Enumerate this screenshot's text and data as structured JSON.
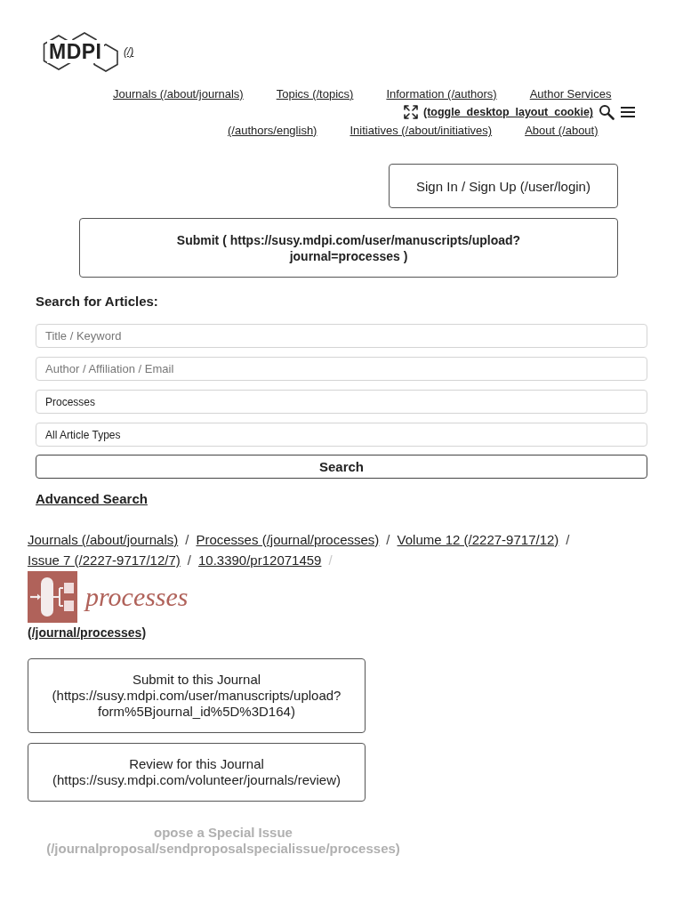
{
  "header": {
    "logo": {
      "text": "MDPI",
      "link": "(/)"
    },
    "nav_rows": [
      [
        {
          "label": "Journals (/about/journals)"
        },
        {
          "label": "Topics (/topics)"
        },
        {
          "label": "Information (/authors)"
        },
        {
          "label": "Author Services"
        }
      ],
      [
        {
          "label": "(/authors/english)"
        },
        {
          "label": "Initiatives (/about/initiatives)"
        },
        {
          "label": "About (/about)"
        }
      ]
    ],
    "layout_toggle": {
      "label": "(toggle_desktop_layout_cookie)"
    },
    "sign_in_button": "Sign In / Sign Up (/user/login)",
    "submit_button": "Submit ( https://susy.mdpi.com/user/manuscripts/upload?journal=processes )"
  },
  "search": {
    "title": "Search for Articles:",
    "fields": [
      {
        "kind": "input",
        "placeholder": "Title / Keyword"
      },
      {
        "kind": "input",
        "placeholder": "Author / Affiliation / Email"
      },
      {
        "kind": "select",
        "value": "Processes"
      },
      {
        "kind": "select",
        "value": "All Article Types"
      }
    ],
    "button": "Search",
    "advanced_link": "Advanced Search"
  },
  "breadcrumb": [
    {
      "kind": "link",
      "text": "Journals (/about/journals)"
    },
    {
      "kind": "separator",
      "text": "/",
      "muted": false
    },
    {
      "kind": "link",
      "text": "Processes (/journal/processes)"
    },
    {
      "kind": "separator",
      "text": "/",
      "muted": false
    },
    {
      "kind": "link",
      "text": "Volume 12 (/2227-9717/12)"
    },
    {
      "kind": "separator",
      "text": "/",
      "muted": false
    },
    {
      "kind": "link",
      "text": "Issue 7 (/2227-9717/12/7)"
    },
    {
      "kind": "separator",
      "text": "/",
      "muted": false
    },
    {
      "kind": "link",
      "text": "10.3390/pr12071459"
    },
    {
      "kind": "separator",
      "text": "/",
      "muted": true
    }
  ],
  "journal": {
    "name": "processes",
    "link": "(/journal/processes)"
  },
  "actions": [
    {
      "label": "Submit to this Journal (https://susy.mdpi.com/user/manuscripts/upload?form%5Bjournal_id%5D%3D164)",
      "faded": false
    },
    {
      "label": "Review for this Journal (https://susy.mdpi.com/volunteer/journals/review)",
      "faded": false
    },
    {
      "label": "opose a Special Issue (/journalproposal/sendproposalspecialissue/processes)",
      "faded": true
    }
  ]
}
